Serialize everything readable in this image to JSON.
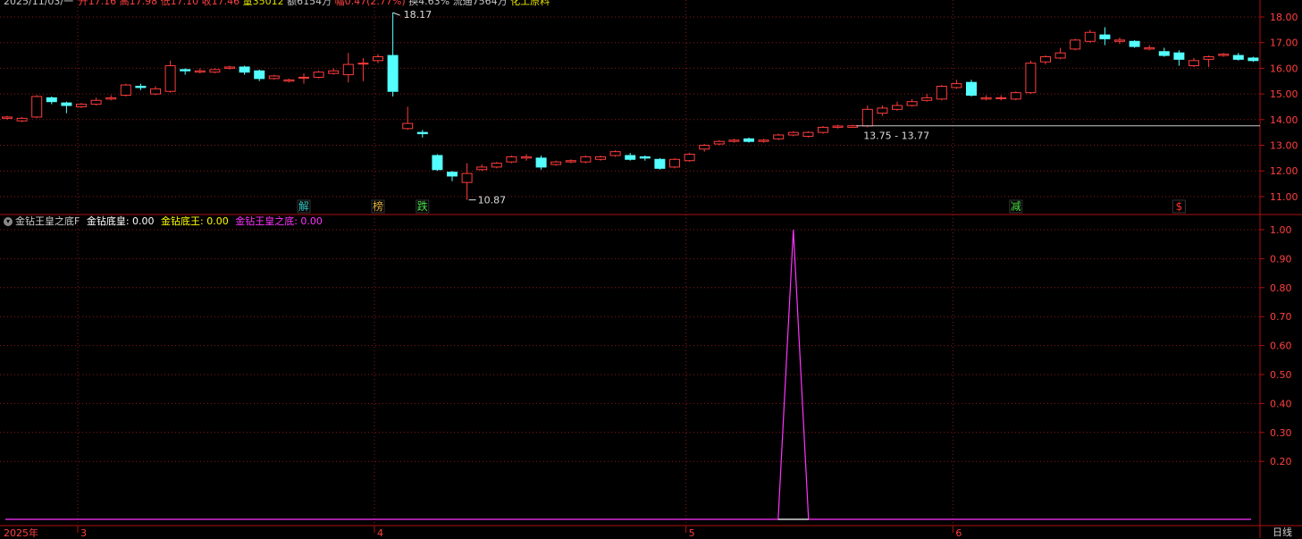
{
  "header": {
    "date": "2025/11/03/一",
    "open_label": "开",
    "open": "17.16",
    "high_label": "高",
    "high": "17.98",
    "low_label": "低",
    "low": "17.10",
    "close_label": "收",
    "close": "17.46",
    "vol_label": "量",
    "vol": "35012",
    "amount": "额6154万",
    "change_label": "幅",
    "change": "0.47(2.77%)",
    "turnover": "换4.63%",
    "float": "流通7564万",
    "sector": "化工原料"
  },
  "indicator": {
    "name": "金钻王皇之底F",
    "items": [
      {
        "label": "金钻底皇: 0.00",
        "color": "#ffffff"
      },
      {
        "label": "金钻底王: 0.00",
        "color": "#ffff00"
      },
      {
        "label": "金钻王皇之底: 0.00",
        "color": "#ff33ff"
      }
    ]
  },
  "annotations": {
    "max_label": "18.17",
    "min_label": "10.87",
    "range_label": "13.75 - 13.77"
  },
  "markers": [
    {
      "text": "解",
      "color": "#35c6c6",
      "index": 20
    },
    {
      "text": "榜",
      "color": "#e0b040",
      "index": 25
    },
    {
      "text": "跌",
      "color": "#4ae04a",
      "index": 28
    },
    {
      "text": "减",
      "color": "#4ae04a",
      "index": 68
    },
    {
      "text": "$",
      "color": "#ff3030",
      "index": 79
    }
  ],
  "period": "日线",
  "colors": {
    "up": "#ff3c3c",
    "down": "#54ffff",
    "grid": "#8b1a1a",
    "axis": "#b01010",
    "line": "#ff33ff"
  },
  "chart_data": {
    "type": "candlestick",
    "price_axis": {
      "ticks": [
        "18.00",
        "17.00",
        "16.00",
        "15.00",
        "14.00",
        "13.00",
        "12.00",
        "11.00"
      ]
    },
    "indicator_axis": {
      "ticks": [
        "1.00",
        "0.90",
        "0.80",
        "0.70",
        "0.60",
        "0.50",
        "0.40",
        "0.30",
        "0.20"
      ]
    },
    "x_labels": [
      {
        "text": "2025年",
        "index": 0
      },
      {
        "text": "3",
        "index": 5
      },
      {
        "text": "4",
        "index": 25
      },
      {
        "text": "5",
        "index": 46
      },
      {
        "text": "6",
        "index": 64
      }
    ],
    "candles": [
      [
        14.05,
        14.1,
        14.15,
        14.0
      ],
      [
        13.95,
        14.05,
        14.1,
        13.9
      ],
      [
        14.1,
        14.9,
        14.95,
        14.05
      ],
      [
        14.85,
        14.7,
        14.9,
        14.6
      ],
      [
        14.65,
        14.55,
        14.7,
        14.25
      ],
      [
        14.5,
        14.6,
        14.65,
        14.45
      ],
      [
        14.6,
        14.75,
        14.85,
        14.55
      ],
      [
        14.8,
        14.85,
        14.95,
        14.75
      ],
      [
        14.95,
        15.35,
        15.4,
        14.9
      ],
      [
        15.3,
        15.25,
        15.4,
        15.15
      ],
      [
        15.0,
        15.2,
        15.3,
        14.95
      ],
      [
        15.1,
        16.1,
        16.3,
        15.05
      ],
      [
        15.95,
        15.9,
        16.0,
        15.75
      ],
      [
        15.85,
        15.9,
        16.0,
        15.8
      ],
      [
        15.85,
        15.95,
        16.0,
        15.8
      ],
      [
        16.0,
        16.05,
        16.1,
        15.95
      ],
      [
        16.05,
        15.85,
        16.1,
        15.75
      ],
      [
        15.9,
        15.6,
        15.95,
        15.5
      ],
      [
        15.6,
        15.7,
        15.75,
        15.55
      ],
      [
        15.5,
        15.55,
        15.6,
        15.45
      ],
      [
        15.65,
        15.65,
        15.8,
        15.4
      ],
      [
        15.65,
        15.85,
        15.9,
        15.6
      ],
      [
        15.8,
        15.9,
        16.0,
        15.75
      ],
      [
        15.75,
        16.15,
        16.6,
        15.45
      ],
      [
        16.2,
        16.2,
        16.4,
        15.5
      ],
      [
        16.3,
        16.45,
        16.55,
        16.2
      ],
      [
        16.5,
        15.1,
        18.17,
        14.9
      ],
      [
        13.65,
        13.85,
        14.5,
        13.6
      ],
      [
        13.5,
        13.45,
        13.6,
        13.3
      ],
      [
        12.6,
        12.05,
        12.65,
        12.0
      ],
      [
        11.95,
        11.8,
        12.0,
        11.6
      ],
      [
        11.55,
        11.9,
        12.3,
        10.87
      ],
      [
        12.05,
        12.15,
        12.25,
        12.0
      ],
      [
        12.15,
        12.3,
        12.35,
        12.1
      ],
      [
        12.35,
        12.55,
        12.6,
        12.3
      ],
      [
        12.5,
        12.55,
        12.65,
        12.4
      ],
      [
        12.5,
        12.15,
        12.6,
        12.05
      ],
      [
        12.25,
        12.35,
        12.4,
        12.2
      ],
      [
        12.35,
        12.4,
        12.45,
        12.3
      ],
      [
        12.35,
        12.55,
        12.6,
        12.3
      ],
      [
        12.45,
        12.55,
        12.6,
        12.4
      ],
      [
        12.6,
        12.75,
        12.8,
        12.55
      ],
      [
        12.6,
        12.45,
        12.7,
        12.4
      ],
      [
        12.55,
        12.5,
        12.6,
        12.4
      ],
      [
        12.45,
        12.1,
        12.5,
        12.05
      ],
      [
        12.15,
        12.45,
        12.5,
        12.1
      ],
      [
        12.4,
        12.65,
        12.7,
        12.35
      ],
      [
        12.85,
        13.0,
        13.05,
        12.75
      ],
      [
        13.05,
        13.15,
        13.2,
        13.0
      ],
      [
        13.15,
        13.2,
        13.25,
        13.1
      ],
      [
        13.25,
        13.15,
        13.3,
        13.1
      ],
      [
        13.15,
        13.2,
        13.25,
        13.1
      ],
      [
        13.25,
        13.4,
        13.45,
        13.2
      ],
      [
        13.4,
        13.5,
        13.55,
        13.35
      ],
      [
        13.35,
        13.5,
        13.55,
        13.3
      ],
      [
        13.5,
        13.7,
        13.75,
        13.45
      ],
      [
        13.7,
        13.75,
        13.8,
        13.65
      ],
      [
        13.7,
        13.76,
        13.8,
        13.7
      ],
      [
        13.75,
        14.4,
        14.55,
        13.7
      ],
      [
        14.25,
        14.45,
        14.55,
        14.15
      ],
      [
        14.4,
        14.55,
        14.7,
        14.35
      ],
      [
        14.55,
        14.7,
        14.8,
        14.5
      ],
      [
        14.75,
        14.85,
        15.0,
        14.7
      ],
      [
        14.8,
        15.3,
        15.35,
        14.75
      ],
      [
        15.25,
        15.4,
        15.55,
        15.2
      ],
      [
        15.45,
        14.95,
        15.55,
        14.9
      ],
      [
        14.8,
        14.85,
        14.95,
        14.75
      ],
      [
        14.85,
        14.85,
        14.95,
        14.75
      ],
      [
        14.8,
        15.05,
        15.1,
        14.75
      ],
      [
        15.05,
        16.2,
        16.3,
        15.0
      ],
      [
        16.25,
        16.45,
        16.5,
        16.15
      ],
      [
        16.4,
        16.6,
        16.8,
        16.35
      ],
      [
        16.75,
        17.1,
        17.15,
        16.7
      ],
      [
        17.05,
        17.4,
        17.5,
        17.0
      ],
      [
        17.3,
        17.15,
        17.6,
        16.9
      ],
      [
        17.05,
        17.1,
        17.2,
        16.95
      ],
      [
        17.05,
        16.85,
        17.1,
        16.8
      ],
      [
        16.75,
        16.8,
        16.9,
        16.7
      ],
      [
        16.65,
        16.5,
        16.8,
        16.45
      ],
      [
        16.6,
        16.35,
        16.7,
        16.1
      ],
      [
        16.1,
        16.3,
        16.4,
        16.05
      ],
      [
        16.35,
        16.45,
        16.5,
        16.05
      ],
      [
        16.5,
        16.55,
        16.6,
        16.45
      ],
      [
        16.5,
        16.35,
        16.6,
        16.3
      ],
      [
        16.4,
        16.3,
        16.45,
        16.25
      ]
    ],
    "indicator_series": {
      "name": "金钻王皇之底",
      "spike_index": 53,
      "spike_value": 1.0
    }
  }
}
